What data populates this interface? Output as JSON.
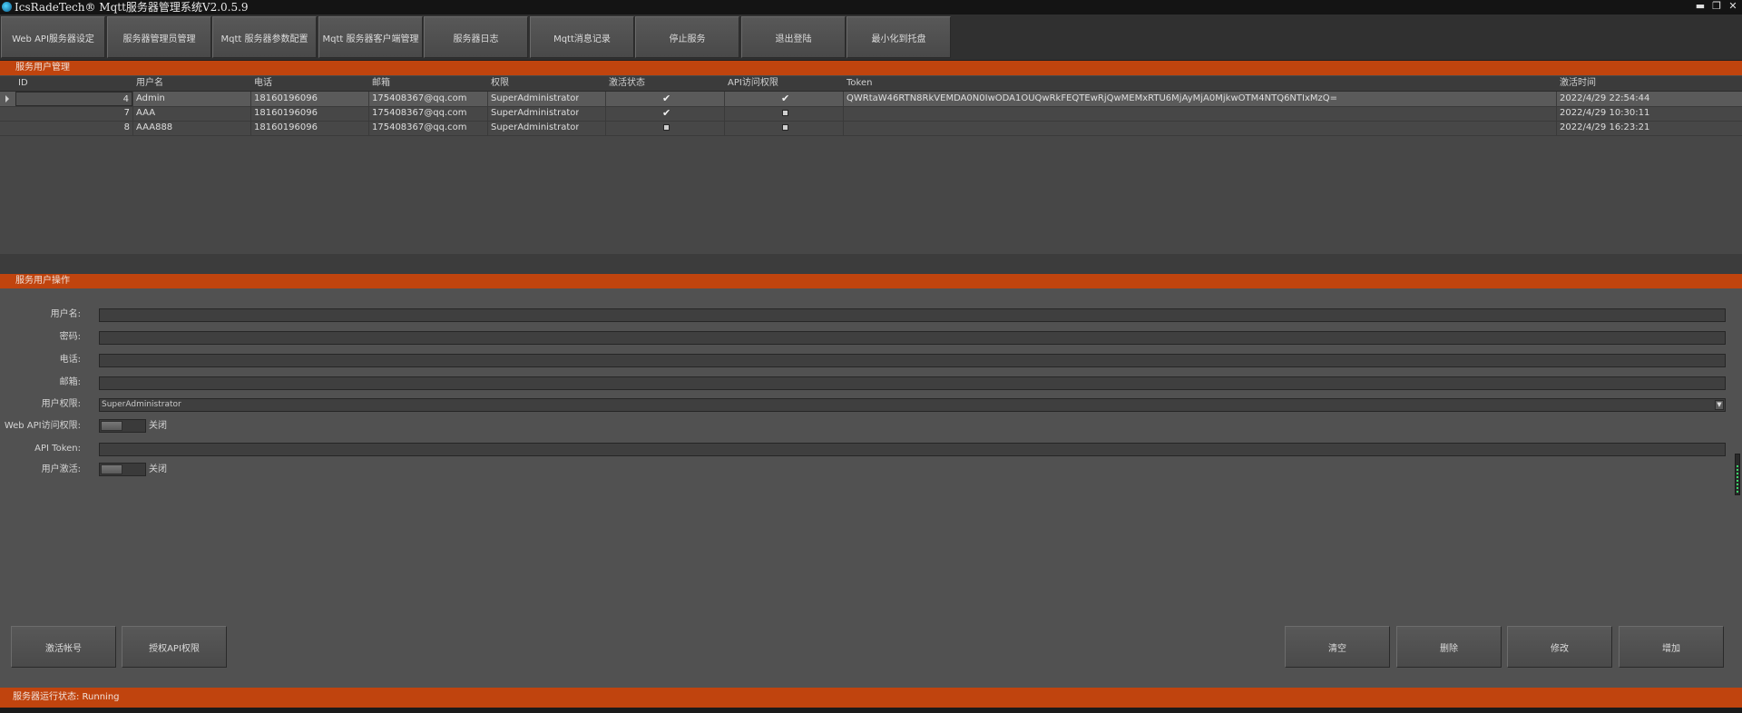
{
  "window": {
    "title": "IcsRadeTech® Mqtt服务器管理系统V2.0.5.9"
  },
  "tabs": [
    "Web API服务器设定",
    "服务器管理员管理",
    "Mqtt 服务器参数配置",
    "Mqtt 服务器客户端管理",
    "服务器日志",
    "Mqtt消息记录",
    "停止服务",
    "退出登陆",
    "最小化到托盘"
  ],
  "user_management": {
    "header": "服务用户管理",
    "columns": [
      "ID",
      "用户名",
      "电话",
      "邮箱",
      "权限",
      "激活状态",
      "API访问权限",
      "Token",
      "激活时间"
    ],
    "rows": [
      {
        "id": "4",
        "username": "Admin",
        "phone": "18160196096",
        "email": "175408367@qq.com",
        "role": "SuperAdministrator",
        "active": true,
        "api_access": true,
        "token": "QWRtaW46RTN8RkVEMDA0N0IwODA1OUQwRkFEQTEwRjQwMEMxRTU6MjAyMjA0MjkwOTM4NTQ6NTIxMzQ=",
        "activated": "2022/4/29 22:54:44"
      },
      {
        "id": "7",
        "username": "AAA",
        "phone": "18160196096",
        "email": "175408367@qq.com",
        "role": "SuperAdministrator",
        "active": true,
        "api_access": false,
        "token": "",
        "activated": "2022/4/29 10:30:11"
      },
      {
        "id": "8",
        "username": "AAA888",
        "phone": "18160196096",
        "email": "175408367@qq.com",
        "role": "SuperAdministrator",
        "active": false,
        "api_access": false,
        "token": "",
        "activated": "2022/4/29 16:23:21"
      }
    ]
  },
  "user_operations": {
    "header": "服务用户操作",
    "username_label": "用户名:",
    "password_label": "密码:",
    "phone_label": "电话:",
    "email_label": "邮箱:",
    "role_label": "用户权限:",
    "role_value": "SuperAdministrator",
    "webapi_label": "Web API访问权限:",
    "webapi_state": "关闭",
    "token_label": "API Token:",
    "activate_label": "用户激活:",
    "activate_state": "关闭"
  },
  "buttons": {
    "activate_account": "激活帐号",
    "grant_api": "授权API权限",
    "clear": "清空",
    "delete": "删除",
    "modify": "修改",
    "add": "增加"
  },
  "status": {
    "text": "服务器运行状态: Running"
  }
}
